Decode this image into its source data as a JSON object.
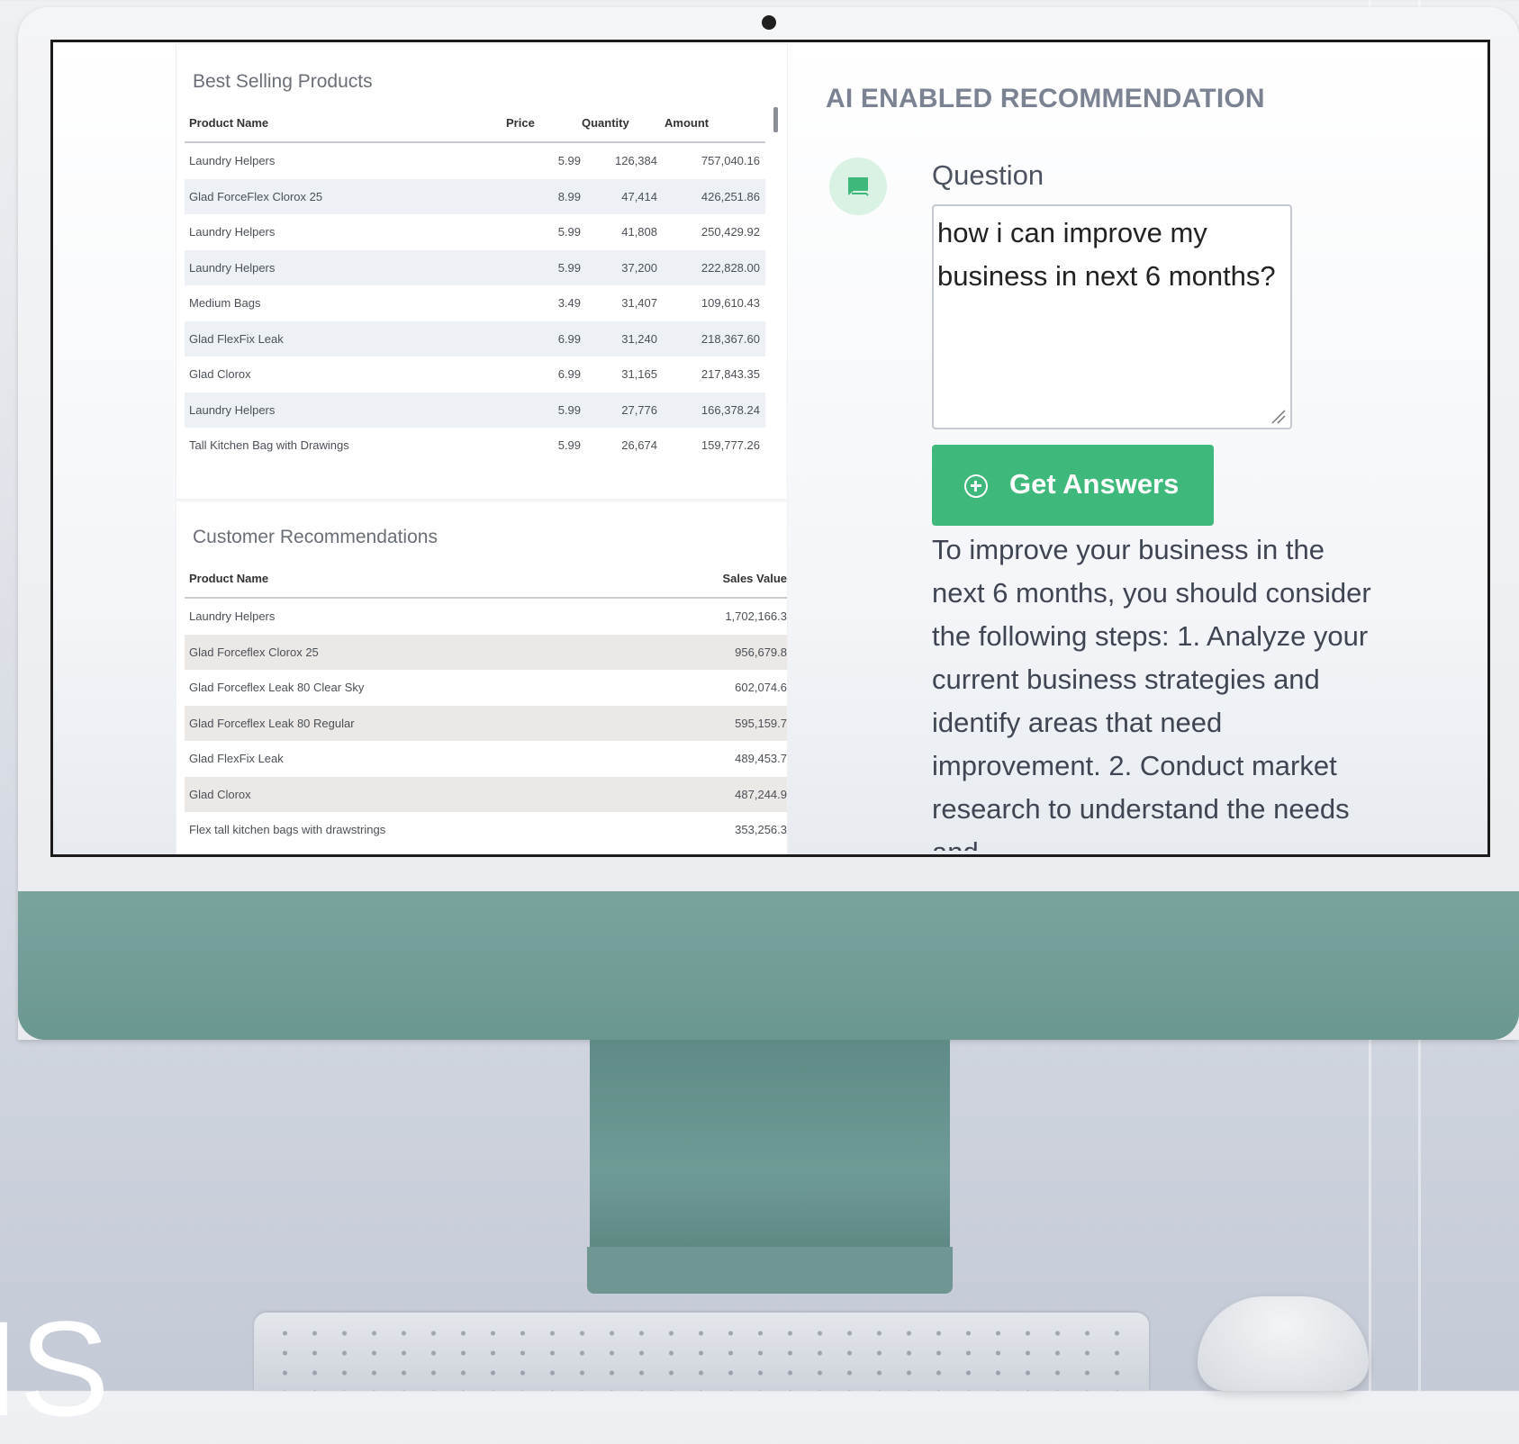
{
  "best_selling": {
    "title": "Best Selling Products",
    "columns": {
      "product": "Product Name",
      "price": "Price",
      "quantity": "Quantity",
      "amount": "Amount"
    },
    "rows": [
      {
        "product": "Laundry Helpers",
        "price": "5.99",
        "quantity": "126,384",
        "amount": "757,040.16"
      },
      {
        "product": "Glad ForceFlex Clorox 25",
        "price": "8.99",
        "quantity": "47,414",
        "amount": "426,251.86"
      },
      {
        "product": "Laundry Helpers",
        "price": "5.99",
        "quantity": "41,808",
        "amount": "250,429.92"
      },
      {
        "product": "Laundry Helpers",
        "price": "5.99",
        "quantity": "37,200",
        "amount": "222,828.00"
      },
      {
        "product": "Medium Bags",
        "price": "3.49",
        "quantity": "31,407",
        "amount": "109,610.43"
      },
      {
        "product": "Glad FlexFix Leak",
        "price": "6.99",
        "quantity": "31,240",
        "amount": "218,367.60"
      },
      {
        "product": "Glad Clorox",
        "price": "6.99",
        "quantity": "31,165",
        "amount": "217,843.35"
      },
      {
        "product": "Laundry Helpers",
        "price": "5.99",
        "quantity": "27,776",
        "amount": "166,378.24"
      },
      {
        "product": "Tall Kitchen Bag with Drawings",
        "price": "5.99",
        "quantity": "26,674",
        "amount": "159,777.26"
      }
    ]
  },
  "customer_recs": {
    "title": "Customer Recommendations",
    "columns": {
      "product": "Product Name",
      "sales": "Sales Value"
    },
    "rows": [
      {
        "product": "Laundry Helpers",
        "sales": "1,702,166.3"
      },
      {
        "product": "Glad Forceflex Clorox 25",
        "sales": "956,679.8"
      },
      {
        "product": "Glad Forceflex Leak 80 Clear Sky",
        "sales": "602,074.6"
      },
      {
        "product": "Glad Forceflex Leak 80 Regular",
        "sales": "595,159.7"
      },
      {
        "product": "Glad FlexFix Leak",
        "sales": "489,453.7"
      },
      {
        "product": "Glad Clorox",
        "sales": "487,244.9"
      },
      {
        "product": "Flex tall kitchen bags with drawstrings",
        "sales": "353,256.3"
      }
    ]
  },
  "ai": {
    "title": "AI ENABLED RECOMMENDATION",
    "question_label": "Question",
    "question_value": "how i can improve my business in next 6 months?",
    "button_label": "Get Answers",
    "answer": "To improve your business in the next 6 months, you should consider the following steps: 1. Analyze your current business strategies and identify areas that need improvement. 2. Conduct market research to understand the needs and"
  },
  "backdrop": {
    "corner_text": "IS"
  },
  "colors": {
    "accent_green": "#3fb87b",
    "chin_teal": "#6b9791",
    "title_gray": "#7b8292"
  }
}
